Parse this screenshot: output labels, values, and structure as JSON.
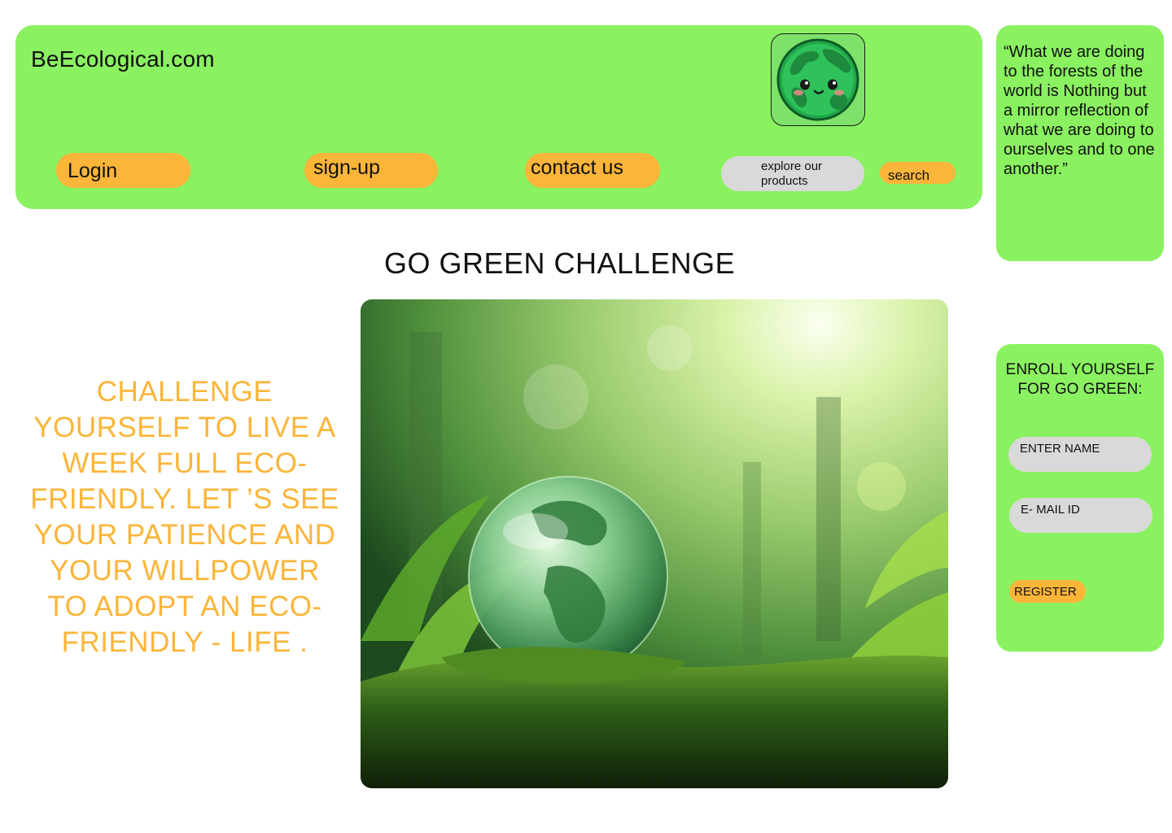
{
  "header": {
    "site_name": "BeEcological.com",
    "logo_icon": "smiling-earth-icon",
    "nav": {
      "login": "Login",
      "signup": "sign-up",
      "contact": "contact us"
    },
    "explore_line1": "explore our",
    "explore_line2": "products",
    "search_label": "search"
  },
  "quote": "“What we are doing to the forests of the world is Nothing but a mirror reflection of what we are doing to ourselves and to one another.”",
  "main": {
    "title": "GO GREEN CHALLENGE",
    "challenge_text": "CHALLENGE YOURSELF TO LIVE A WEEK FULL ECO-FRIENDLY. LET ’S SEE YOUR PATIENCE AND YOUR WILLPOWER TO ADOPT AN ECO-FRIENDLY - LIFE .",
    "hero_image": "glass-globe-on-moss-in-forest"
  },
  "enroll": {
    "title": "ENROLL YOURSELF FOR GO GREEN:",
    "name_placeholder": "ENTER NAME",
    "email_placeholder": "E- MAIL ID",
    "register_label": "REGISTER"
  },
  "colors": {
    "panel_green": "#8af160",
    "accent_orange": "#fbb539",
    "field_gray": "#d9d9d9"
  }
}
